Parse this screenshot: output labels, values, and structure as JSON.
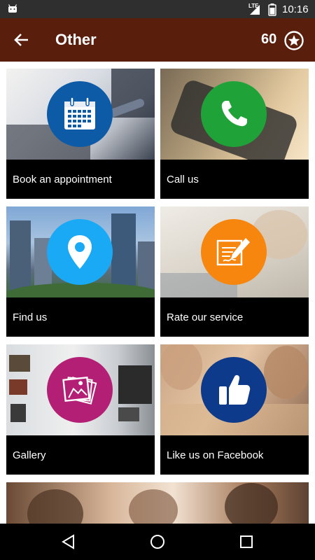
{
  "status_bar": {
    "network": "LTE",
    "time": "10:16",
    "icons": [
      "android-icon",
      "lte-signal-icon",
      "battery-icon"
    ]
  },
  "app_bar": {
    "title": "Other",
    "points": "60",
    "icons": [
      "back-arrow-icon",
      "star-badge-icon"
    ],
    "color": "#5a1e0c"
  },
  "tiles": [
    {
      "label": "Book an appointment",
      "icon": "calendar-icon",
      "badge_color": "#0d5aa7"
    },
    {
      "label": "Call us",
      "icon": "phone-icon",
      "badge_color": "#1fa339"
    },
    {
      "label": "Find us",
      "icon": "map-pin-icon",
      "badge_color": "#1aa9f5"
    },
    {
      "label": "Rate our service",
      "icon": "review-pen-icon",
      "badge_color": "#f7860f"
    },
    {
      "label": "Gallery",
      "icon": "photos-icon",
      "badge_color": "#b21f74"
    },
    {
      "label": "Like us on Facebook",
      "icon": "thumbs-up-icon",
      "badge_color": "#0d3a8a"
    }
  ],
  "nav_bar": {
    "icons": [
      "back-triangle-icon",
      "home-circle-icon",
      "recents-square-icon"
    ]
  }
}
